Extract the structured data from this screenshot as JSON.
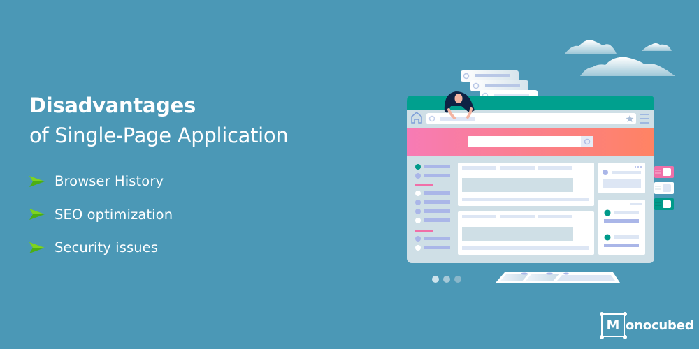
{
  "heading": {
    "line1": "Disadvantages",
    "line2": "of Single-Page Application"
  },
  "bullets": [
    {
      "icon": "green-arrow-icon",
      "label": "Browser History"
    },
    {
      "icon": "green-arrow-icon",
      "label": "SEO optimization"
    },
    {
      "icon": "green-arrow-icon",
      "label": "Security issues"
    }
  ],
  "brand": {
    "logo_letter": "M",
    "logo_text": "onocubed"
  },
  "colors": {
    "background": "#4b98b6",
    "browser_header": "#00a08e",
    "hero_gradient_start": "#f77bb5",
    "hero_gradient_end": "#ff8363",
    "arrow_green": "#5dc21e",
    "accent_teal": "#009a8a",
    "accent_pink": "#f06fa8",
    "placeholder_blue": "#aab6e8"
  },
  "carousel": {
    "dots": 3,
    "active_index": 0
  }
}
